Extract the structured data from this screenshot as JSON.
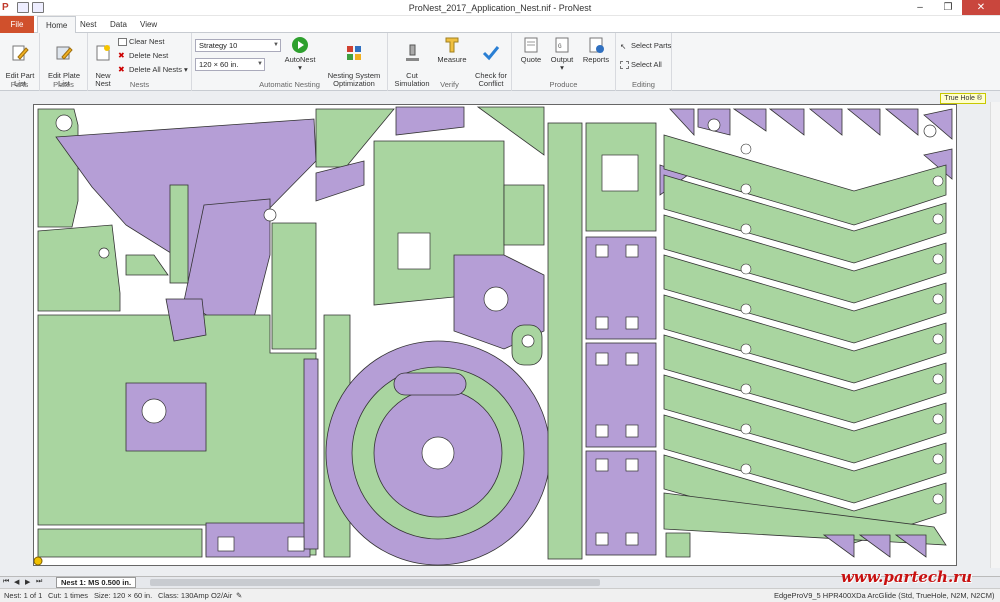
{
  "window": {
    "title": "ProNest_2017_Application_Nest.nif - ProNest"
  },
  "tabs": [
    {
      "label": "File"
    },
    {
      "label": "Home"
    },
    {
      "label": "Nest"
    },
    {
      "label": "Data"
    },
    {
      "label": "View"
    }
  ],
  "ribbon": {
    "parts": {
      "edit_part_list": "Edit Part\nList",
      "group": "Parts"
    },
    "plates": {
      "edit_plate_list": "Edit Plate\nList",
      "group": "Plates"
    },
    "nests": {
      "new_nest": "New\nNest",
      "clear_nest": "Clear Nest",
      "delete_nest": "Delete Nest",
      "delete_all_nests": "Delete All Nests",
      "group": "Nests"
    },
    "autonest": {
      "strategy": "Strategy 10",
      "plate_size": "120 × 60 in.",
      "autonest": "AutoNest",
      "nso": "Nesting System\nOptimization",
      "group": "Automatic Nesting"
    },
    "verify": {
      "cut_sim": "Cut\nSimulation",
      "measure": "Measure",
      "check_conflict": "Check for\nConflict",
      "group": "Verify"
    },
    "produce": {
      "quote": "Quote",
      "output": "Output",
      "reports": "Reports",
      "group": "Produce"
    },
    "editing": {
      "select_parts": "Select Parts",
      "select_all": "Select All",
      "group": "Editing"
    }
  },
  "workspace": {
    "true_hole": "True Hole ®"
  },
  "nav": {
    "nest_tab": "Nest 1: MS 0.500 in."
  },
  "status": {
    "nest": "Nest: 1 of 1",
    "cut": "Cut: 1 times",
    "size": "Size: 120 × 60 in.",
    "class": "Class: 130Amp O2/Air",
    "machine": "EdgeProV9_5 HPR400XDa ArcGlide (Std, TrueHole, N2M, N2CM)"
  },
  "watermark": "www.partech.ru",
  "colors": {
    "part_green": "#a9d5a0",
    "part_purple": "#b59ed6",
    "part_outline": "#333333",
    "plate": "#ffffff",
    "file_tab": "#d0502c"
  }
}
